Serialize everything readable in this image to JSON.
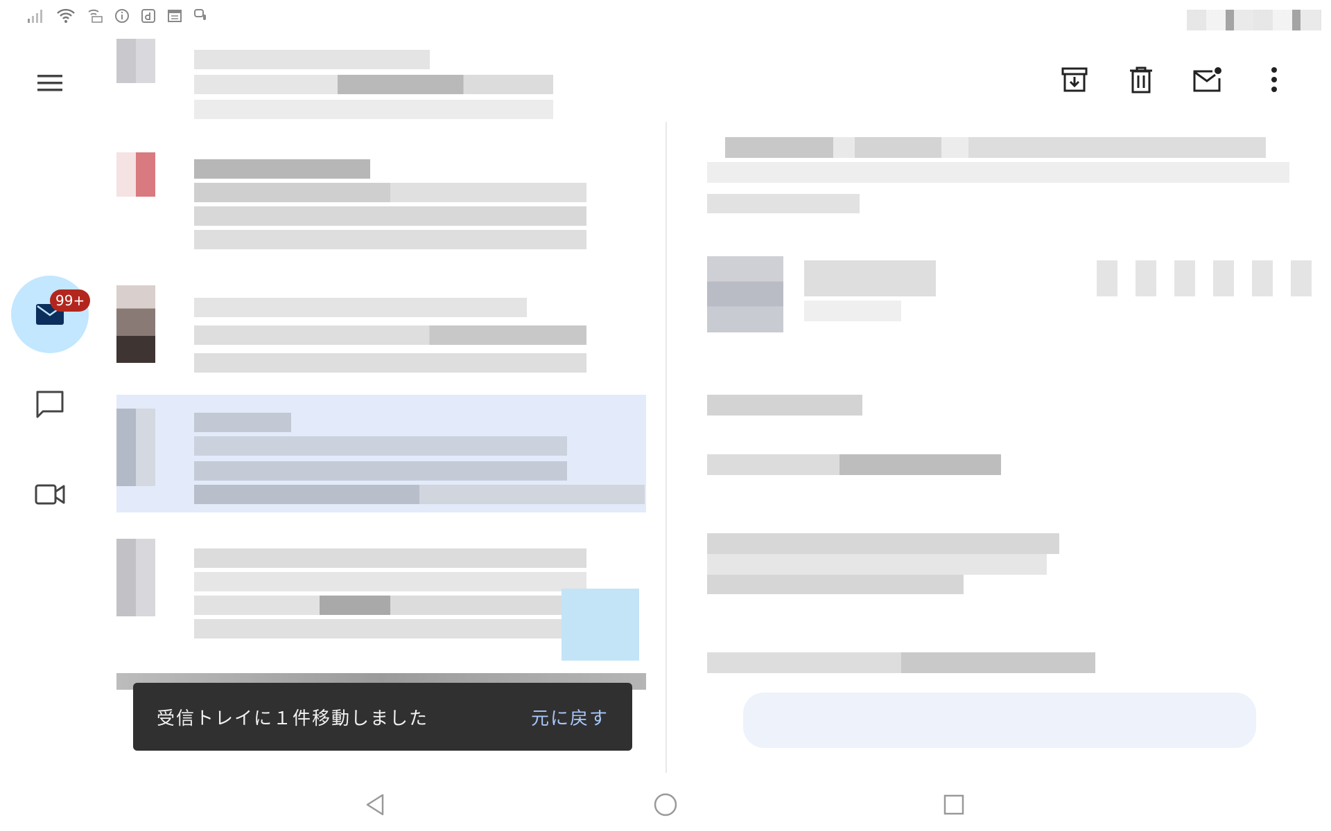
{
  "mail": {
    "badge": "99+"
  },
  "snackbar": {
    "message": "受信トレイに１件移動しました",
    "action": "元に戻す"
  },
  "colors": {
    "accent": "#c2e7ff",
    "badge": "#b3261e",
    "snackbar_bg": "#303030",
    "snackbar_action": "#a8c7fa",
    "selected_row": "#e3ebfa"
  },
  "icons": {
    "menu": "menu-icon",
    "mail": "mail-icon",
    "chat": "chat-icon",
    "meet": "video-icon",
    "archive": "archive-icon",
    "delete": "trash-icon",
    "unread": "mark-unread-icon",
    "more": "more-vert-icon"
  }
}
